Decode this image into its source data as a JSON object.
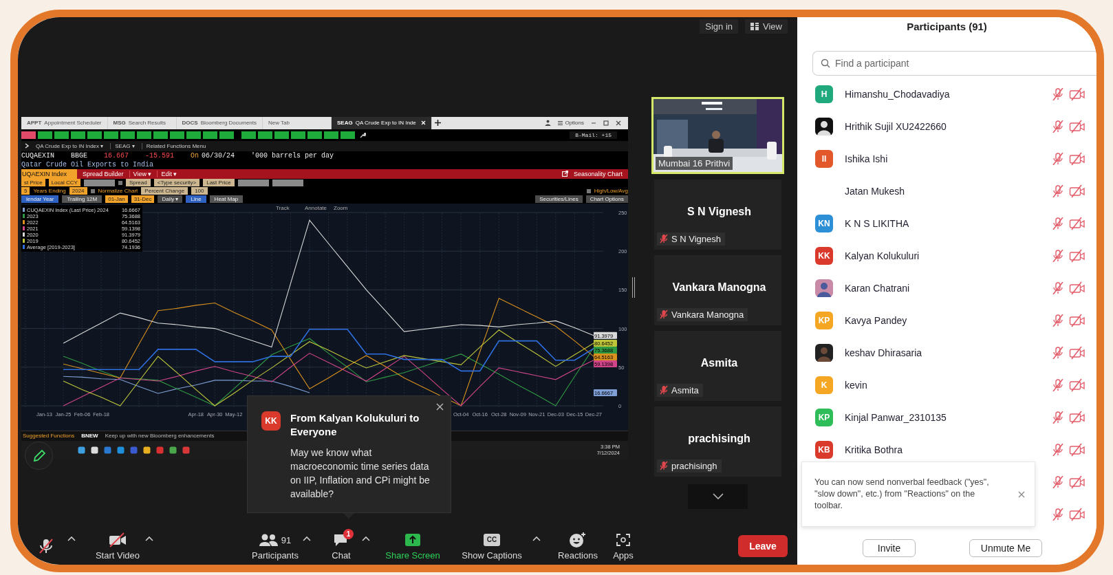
{
  "top_bar": {
    "sign_in": "Sign in",
    "view": "View"
  },
  "shared_screen": {
    "tabs": [
      {
        "code": "APPT",
        "label": "Appointment Scheduler",
        "selected": false
      },
      {
        "code": "MSG",
        "label": "Search Results",
        "selected": false
      },
      {
        "code": "DOCS",
        "label": "Bloomberg Documents",
        "selected": false
      },
      {
        "label": "New Tab",
        "selected": false
      },
      {
        "code": "SEAG",
        "label": "QA Crude Exp to IN Inde",
        "selected": true
      }
    ],
    "options": "Options",
    "function_keys": [
      {
        "kind": "alert"
      },
      {
        "kind": "key"
      },
      {
        "kind": "key"
      },
      {
        "kind": "key"
      },
      {
        "kind": "key"
      },
      {
        "kind": "key"
      },
      {
        "kind": "key"
      },
      {
        "kind": "key"
      },
      {
        "kind": "key"
      },
      {
        "kind": "key"
      },
      {
        "kind": "key"
      },
      {
        "kind": "key"
      },
      {
        "kind": "key"
      },
      {
        "kind": "key"
      },
      {
        "kind": "key"
      },
      {
        "kind": "key"
      },
      {
        "kind": "key"
      },
      {
        "kind": "key"
      },
      {
        "kind": "key"
      },
      {
        "kind": "key"
      }
    ],
    "bmail": "B-Mail: +15",
    "breadcrumb": [
      "QA Crude Exp to IN Index ▾",
      "SEAG ▾",
      "Related Functions Menu"
    ],
    "ticker": [
      {
        "text": "CUQAEXIN",
        "kind": "plain"
      },
      {
        "text": "BBGE",
        "kind": "plain"
      },
      {
        "text": "16.667",
        "kind": "down"
      },
      {
        "text": "-15.591",
        "kind": "down"
      },
      {
        "text": "On",
        "kind": "label"
      },
      {
        "text": "06/30/24",
        "kind": "plain"
      },
      {
        "text": "'000 barrels per day",
        "kind": "plain"
      }
    ],
    "title": "Qatar Crude Oil Exports to India",
    "menu_bar": {
      "security": "UQAEXIN Index",
      "items": [
        "Spread Builder",
        "View ▾",
        "Edit ▾"
      ],
      "chart_name": "Seasonality Chart"
    },
    "control_rows": [
      {
        "left": [
          {
            "kind": "orange",
            "text": "st Price"
          },
          {
            "kind": "orange",
            "text": "Local CCY"
          },
          {
            "kind": "empty"
          },
          {
            "kind": "check",
            "checked": false
          },
          {
            "kind": "field",
            "text": "Spread"
          },
          {
            "kind": "field",
            "text": "<Type security>"
          },
          {
            "kind": "field",
            "text": "Last Price"
          },
          {
            "kind": "empty"
          },
          {
            "kind": "empty"
          }
        ],
        "right": []
      },
      {
        "left": [
          {
            "kind": "orange",
            "text": "5"
          },
          {
            "kind": "text",
            "text": "Years Ending"
          },
          {
            "kind": "orange",
            "text": "2024"
          },
          {
            "kind": "check",
            "checked": false
          },
          {
            "kind": "text",
            "text": "Normalize Chart"
          },
          {
            "kind": "field",
            "text": "Percent Change"
          },
          {
            "kind": "field",
            "text": "100"
          }
        ],
        "right": [
          {
            "kind": "check",
            "checked": false
          },
          {
            "kind": "text",
            "text": "High/Low/Avg"
          }
        ]
      },
      {
        "left": [
          {
            "kind": "tab",
            "text": "lendar Year",
            "selected": true
          },
          {
            "kind": "tab",
            "text": "Trailing 12M",
            "selected": false
          },
          {
            "kind": "orange",
            "text": "01-Jan"
          },
          {
            "kind": "orange",
            "text": "31-Dec"
          },
          {
            "kind": "dropdown",
            "text": "Daily ▾"
          },
          {
            "kind": "tab",
            "text": "Line",
            "selected": true
          },
          {
            "kind": "tab",
            "text": "Heat Map",
            "selected": false
          }
        ],
        "right": [
          {
            "kind": "dropdown",
            "text": "Securities/Lines"
          },
          {
            "kind": "dropdown",
            "text": "Chart Options"
          }
        ]
      }
    ],
    "chart_tools": [
      "Track",
      "Annotate",
      "Zoom"
    ],
    "legend": [
      {
        "value": "16.6667"
      },
      {
        "value": "75.3688"
      },
      {
        "value": "64.5163"
      },
      {
        "value": "59.1398"
      },
      {
        "value": "91.3979"
      },
      {
        "value": "80.6452"
      },
      {
        "value": "74.1936"
      }
    ],
    "value_tags": [
      {
        "text": "91.3979",
        "color": "#d9d9d9"
      },
      {
        "text": "80.6452",
        "color": "#bfc63a"
      },
      {
        "text": "75.3688",
        "color": "#2f9a44"
      },
      {
        "text": "64.5163",
        "color": "#d8901e"
      },
      {
        "text": "59.1398",
        "color": "#d0458a"
      },
      {
        "text": "16.6667",
        "color": "#7f9fd6"
      }
    ],
    "chart_data": {
      "type": "line",
      "ylim": [
        0,
        250
      ],
      "yticks": [
        0,
        50,
        100,
        150,
        200,
        250
      ],
      "grid": true,
      "legend": "top-left",
      "categories": [
        null,
        "Jan-13",
        "Jan-25",
        "Feb-06",
        "Feb-18",
        null,
        null,
        null,
        null,
        "Apr-18",
        "Apr-30",
        "May-12",
        null,
        null,
        null,
        null,
        null,
        null,
        null,
        null,
        null,
        null,
        null,
        "Oct-04",
        "Oct-16",
        "Oct-28",
        "Nov-09",
        "Nov-21",
        "Dec-03",
        "Dec-15",
        "Dec-27"
      ],
      "series": [
        {
          "name": "CUQAEXIN Index (Last Price) 2024",
          "color": "#7f9fd6",
          "values": [
            null,
            null,
            38,
            37,
            35,
            34,
            25,
            16,
            22,
            27,
            33,
            33,
            32,
            32,
            25,
            17,
            null,
            null,
            null,
            null,
            null,
            null,
            null,
            null,
            null,
            null,
            null,
            null,
            null,
            null,
            null
          ]
        },
        {
          "name": "2023",
          "color": "#2f9a44",
          "values": [
            null,
            null,
            64,
            55,
            45,
            36,
            35,
            33,
            22,
            11,
            0,
            22,
            44,
            66,
            77,
            87,
            68,
            50,
            31,
            37,
            43,
            51,
            59,
            67,
            54,
            41,
            27,
            14,
            0,
            38,
            75
          ]
        },
        {
          "name": "2022",
          "color": "#d8901e",
          "values": [
            null,
            null,
            54,
            48,
            42,
            36,
            80,
            123,
            126,
            130,
            133,
            121,
            110,
            98,
            60,
            22,
            36,
            51,
            65,
            51,
            36,
            24,
            12,
            0,
            70,
            139,
            127,
            115,
            103,
            84,
            64
          ]
        },
        {
          "name": "2021",
          "color": "#d0458a",
          "values": [
            null,
            null,
            0,
            12,
            24,
            36,
            34,
            32,
            38,
            45,
            51,
            44,
            38,
            31,
            50,
            68,
            56,
            44,
            32,
            48,
            64,
            43,
            21,
            0,
            25,
            49,
            44,
            39,
            34,
            47,
            59
          ]
        },
        {
          "name": "2020",
          "color": "#d9d9d9",
          "values": [
            null,
            null,
            81,
            94,
            107,
            120,
            114,
            107,
            105,
            102,
            100,
            92,
            84,
            76,
            158,
            240,
            210,
            180,
            150,
            123,
            96,
            99,
            102,
            105,
            104,
            102,
            105,
            107,
            110,
            101,
            91
          ]
        },
        {
          "name": "2019",
          "color": "#bfc63a",
          "values": [
            null,
            null,
            32,
            21,
            11,
            0,
            32,
            64,
            43,
            21,
            0,
            16,
            33,
            49,
            66,
            83,
            72,
            60,
            49,
            57,
            65,
            61,
            57,
            53,
            76,
            98,
            82,
            67,
            51,
            66,
            81
          ]
        },
        {
          "name": "Average [2019-2023]",
          "color": "#2e6fe0",
          "values": [
            null,
            null,
            47,
            47,
            47,
            47,
            47,
            73,
            73,
            73,
            57,
            57,
            57,
            64,
            64,
            99,
            99,
            99,
            67,
            67,
            60,
            60,
            60,
            45,
            45,
            84,
            84,
            84,
            59,
            59,
            74
          ]
        }
      ]
    },
    "suggested": {
      "heading": "Suggested Functions",
      "code": "BNEW",
      "text": "Keep up with new Bloomberg enhancements"
    },
    "taskbar": {
      "time": "3:38 PM",
      "date": "7/12/2024"
    }
  },
  "video_tiles": [
    {
      "kind": "video",
      "label": "Mumbai 16 Prithvi",
      "highlighted": true
    },
    {
      "kind": "name",
      "name": "S N Vignesh",
      "label": "S N Vignesh",
      "muted": true
    },
    {
      "kind": "name",
      "name": "Vankara Manogna",
      "label": "Vankara Manogna",
      "muted": true
    },
    {
      "kind": "name",
      "name": "Asmita",
      "label": "Asmita",
      "muted": true
    },
    {
      "kind": "name",
      "name": "prachisingh",
      "label": "prachisingh",
      "muted": true
    }
  ],
  "chat_popup": {
    "initials": "KK",
    "color": "#d93a2b",
    "heading": "From Kalyan Kolukuluri to Everyone",
    "message": "May we know what macroeconomic time series data on IIP, Inflation and CPi might be available?"
  },
  "toolbar": {
    "muted": true,
    "video": {
      "label": "Start Video",
      "off": true
    },
    "participants": {
      "label": "Participants",
      "count": "91"
    },
    "chat": {
      "label": "Chat",
      "badge": "1"
    },
    "share": "Share Screen",
    "captions": {
      "label": "Show Captions",
      "icon_text": "CC"
    },
    "reactions": "Reactions",
    "apps": "Apps",
    "leave": "Leave"
  },
  "participants": {
    "title": "Participants (91)",
    "search": {
      "placeholder": "Find a participant"
    },
    "list": [
      {
        "kind": "initials",
        "initials": "H",
        "color": "#1fa97c",
        "name": "Himanshu_Chodavadiya",
        "muted": true,
        "video_off": true
      },
      {
        "name": "Hrithik Sujil XU2422660",
        "muted": true,
        "video_off": true
      },
      {
        "kind": "initials",
        "initials": "II",
        "color": "#e2582a",
        "name": "Ishika Ishi",
        "muted": true,
        "video_off": true
      },
      {
        "kind": "none",
        "name": "Jatan Mukesh",
        "muted": true,
        "video_off": true
      },
      {
        "kind": "initials",
        "initials": "KN",
        "color": "#2d8fd5",
        "name": "K N S LIKITHA",
        "muted": true,
        "video_off": true
      },
      {
        "kind": "initials",
        "initials": "KK",
        "color": "#d93a2b",
        "name": "Kalyan Kolukuluri",
        "muted": true,
        "video_off": true
      },
      {
        "name": "Karan Chatrani",
        "muted": true,
        "video_off": true
      },
      {
        "kind": "initials",
        "initials": "KP",
        "color": "#f5a623",
        "name": "Kavya Pandey",
        "muted": true,
        "video_off": true
      },
      {
        "name": "keshav Dhirasaria",
        "muted": true,
        "video_off": true
      },
      {
        "kind": "initials",
        "initials": "K",
        "color": "#f5a623",
        "name": "kevin",
        "muted": true,
        "video_off": true
      },
      {
        "kind": "initials",
        "initials": "KP",
        "color": "#2ebd59",
        "name": "Kinjal Panwar_2310135",
        "muted": true,
        "video_off": true
      },
      {
        "kind": "initials",
        "initials": "KB",
        "color": "#d93a2b",
        "name": "Kritika Bothra",
        "muted": true,
        "video_off": true
      },
      {
        "kind": "hidden",
        "muted": true,
        "video_off": true
      },
      {
        "kind": "hidden",
        "muted": true,
        "video_off": true
      }
    ],
    "notice": "You can now send nonverbal feedback (\"yes\", \"slow down\", etc.) from \"Reactions\" on the toolbar.",
    "buttons": [
      "Invite",
      "Unmute Me"
    ]
  }
}
